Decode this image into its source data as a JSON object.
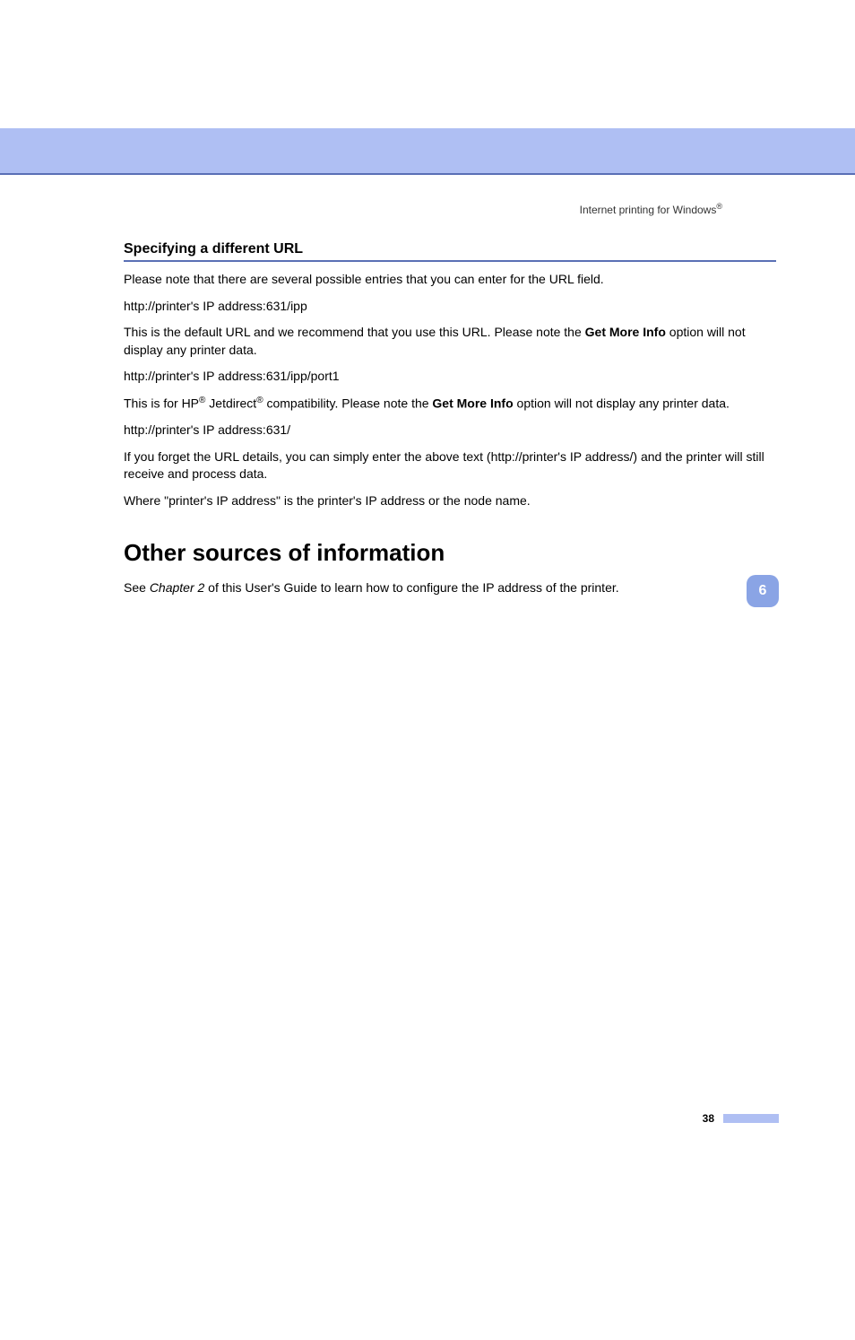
{
  "breadcrumb": {
    "text": "Internet printing for Windows",
    "reg": "®"
  },
  "subsection": "Specifying a different URL",
  "p1": "Please note that there are several possible entries that you can enter for the URL field.",
  "p2": "http://printer's IP address:631/ipp",
  "p3a": "This is the default URL and we recommend that you use this URL. Please note the ",
  "p3b": "Get More Info",
  "p3c": " option will not display any printer data.",
  "p4": "http://printer's IP address:631/ipp/port1",
  "p5a": "This is for HP",
  "p5reg1": "®",
  "p5b": " Jetdirect",
  "p5reg2": "®",
  "p5c": " compatibility. Please note the ",
  "p5d": "Get More Info",
  "p5e": " option will not display any printer data.",
  "p6": "http://printer's IP address:631/",
  "p7": "If you forget the URL details, you can simply enter the above text (http://printer's IP address/) and the printer will still receive and process data.",
  "p8": "Where \"printer's IP address\" is the printer's IP address or the node name.",
  "section": "Other sources of information",
  "p9a": "See ",
  "p9b": "Chapter 2",
  "p9c": " of this User's Guide to learn how to configure the IP address of the printer.",
  "chapterTab": "6",
  "pageNumber": "38"
}
